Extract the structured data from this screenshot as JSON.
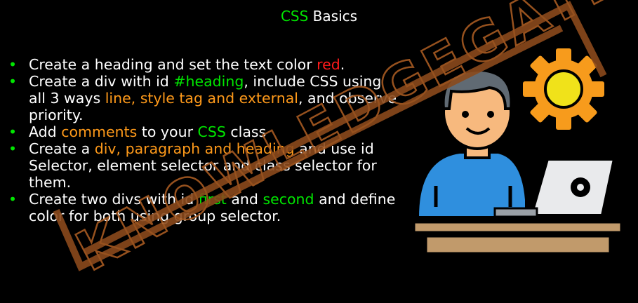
{
  "title": {
    "accent": "CSS",
    "rest": " Basics"
  },
  "bullets": [
    {
      "parts": [
        {
          "text": "Create a heading and set the text color ",
          "color": "white"
        },
        {
          "text": "red",
          "color": "red"
        },
        {
          "text": ".",
          "color": "white"
        }
      ]
    },
    {
      "parts": [
        {
          "text": "Create a div with id ",
          "color": "white"
        },
        {
          "text": "#heading",
          "color": "green"
        },
        {
          "text": ", include CSS using all 3 ways ",
          "color": "white"
        },
        {
          "text": "line, style tag and external",
          "color": "orange"
        },
        {
          "text": ", and observe priority.",
          "color": "white"
        }
      ]
    },
    {
      "parts": [
        {
          "text": "Add ",
          "color": "white"
        },
        {
          "text": "comments",
          "color": "orange"
        },
        {
          "text": " to your ",
          "color": "white"
        },
        {
          "text": "CSS",
          "color": "green"
        },
        {
          "text": " class",
          "color": "white"
        }
      ]
    },
    {
      "parts": [
        {
          "text": "Create a ",
          "color": "white"
        },
        {
          "text": "div, paragraph and heading",
          "color": "orange"
        },
        {
          "text": " and use id Selector, element selector and class selector for them.",
          "color": "white"
        }
      ]
    },
    {
      "parts": [
        {
          "text": "Create two divs with id ",
          "color": "white"
        },
        {
          "text": "first",
          "color": "green"
        },
        {
          "text": " and ",
          "color": "white"
        },
        {
          "text": "second",
          "color": "green"
        },
        {
          "text": " and define color for both using group selector.",
          "color": "white"
        }
      ]
    }
  ],
  "bullet_glyph": "•",
  "watermark": {
    "text": "KNOWLEDGEGATE"
  },
  "illustration": {
    "icons": [
      "person-avatar-icon",
      "gear-icon",
      "laptop-icon",
      "desk-icon"
    ]
  },
  "colors": {
    "background": "#000000",
    "text": "#ffffff",
    "green": "#00e600",
    "orange": "#ff9a1a",
    "red": "#ff1a1a",
    "watermark": "#8b4a1c"
  }
}
